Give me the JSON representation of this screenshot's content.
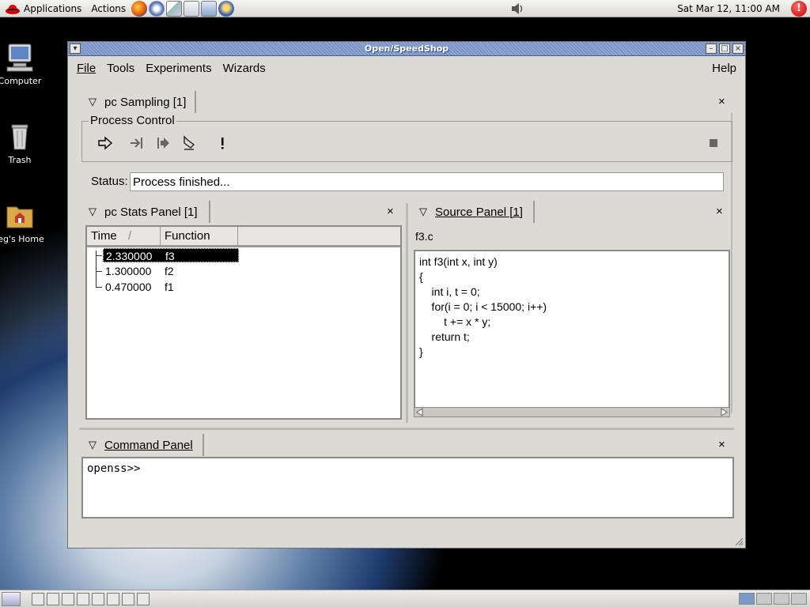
{
  "top_panel": {
    "menus": [
      "Applications",
      "Actions"
    ],
    "launchers": [
      "firefox-icon",
      "evolution-icon",
      "writer-icon",
      "impress-icon",
      "calc-icon",
      "print-icon"
    ],
    "clock": "Sat Mar 12, 11:00 AM"
  },
  "desktop": {
    "icons": [
      {
        "label": "Computer"
      },
      {
        "label": "Trash"
      },
      {
        "label": "jeg's Home"
      }
    ]
  },
  "window": {
    "title": "Open/SpeedShop",
    "menubar": {
      "file": "File",
      "tools": "Tools",
      "experiments": "Experiments",
      "wizards": "Wizards",
      "help": "Help"
    },
    "pc_sampling_tab": "pc Sampling [1]",
    "process_control_label": "Process Control",
    "status_label": "Status:",
    "status_value": "Process finished...",
    "stats_panel": {
      "tab": "pc Stats Panel [1]",
      "columns": {
        "time": "Time",
        "function": "Function"
      },
      "sort_indicator": "/",
      "rows": [
        {
          "time": "2.330000",
          "function": "f3",
          "selected": true
        },
        {
          "time": "1.300000",
          "function": "f2",
          "selected": false
        },
        {
          "time": "0.470000",
          "function": "f1",
          "selected": false
        }
      ]
    },
    "source_panel": {
      "tab": "Source Panel [1]",
      "file": "f3.c",
      "lines": [
        "int f3(int x, int y)",
        "{",
        "    int i, t = 0;",
        "",
        "    for(i = 0; i < 15000; i++)",
        "        t += x * y;",
        "    return t;",
        "}"
      ]
    },
    "command_panel": {
      "tab": "Command Panel",
      "prompt": "openss>>"
    }
  },
  "colors": {
    "titlebar": "#7f97c6",
    "window_bg": "#dcdad5",
    "selection": "#000000"
  }
}
